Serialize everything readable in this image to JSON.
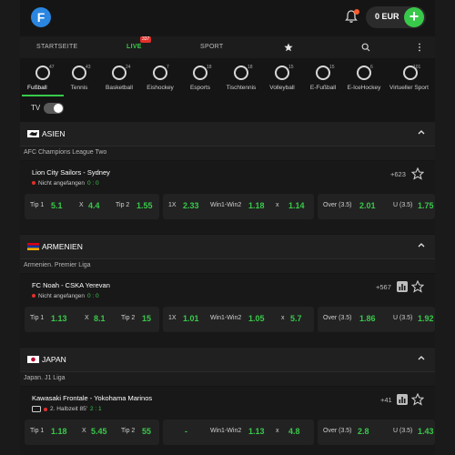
{
  "header": {
    "logo": "F",
    "balance": "0 EUR",
    "plus": "+"
  },
  "nav": {
    "home": "STARTSEITE",
    "live": "LIVE",
    "live_count": "337",
    "sport": "SPORT"
  },
  "sports": [
    {
      "label": "Fußball",
      "count": "47"
    },
    {
      "label": "Tennis",
      "count": "43"
    },
    {
      "label": "Basketball",
      "count": "24"
    },
    {
      "label": "Eishockey",
      "count": "7"
    },
    {
      "label": "Esports",
      "count": "18"
    },
    {
      "label": "Tischtennis",
      "count": "18"
    },
    {
      "label": "Volleyball",
      "count": "15"
    },
    {
      "label": "E-Fußball",
      "count": "15"
    },
    {
      "label": "E-IceHockey",
      "count": "6"
    },
    {
      "label": "Virtueller Sport",
      "count": "101"
    }
  ],
  "tv_label": "TV",
  "sections": [
    {
      "country": "ASIEN",
      "league": "AFC Champions League Two",
      "teams": "Lion City Sailors - Sydney",
      "status": "Nicht angefangen",
      "score": "0 : 0",
      "more": "+623",
      "odds1": [
        {
          "l": "Tip 1",
          "v": "5.1"
        },
        {
          "l": "X",
          "v": "4.4"
        },
        {
          "l": "Tip 2",
          "v": "1.55"
        }
      ],
      "odds2": [
        {
          "l": "1X",
          "v": "2.33"
        },
        {
          "l": "Win1-Win2",
          "v": "1.18"
        },
        {
          "l": "x",
          "v": "1.14"
        }
      ],
      "odds3": [
        {
          "l": "Over (3.5)",
          "v": "2.01"
        },
        {
          "l": "U (3.5)",
          "v": "1.75"
        }
      ]
    },
    {
      "country": "ARMENIEN",
      "league": "Armenien. Premier Liga",
      "teams": "FC Noah - CSKA Yerevan",
      "status": "Nicht angefangen",
      "score": "0 : 0",
      "more": "+567",
      "odds1": [
        {
          "l": "Tip 1",
          "v": "1.13"
        },
        {
          "l": "X",
          "v": "8.1"
        },
        {
          "l": "Tip 2",
          "v": "15"
        }
      ],
      "odds2": [
        {
          "l": "1X",
          "v": "1.01"
        },
        {
          "l": "Win1-Win2",
          "v": "1.05"
        },
        {
          "l": "x",
          "v": "5.7"
        }
      ],
      "odds3": [
        {
          "l": "Over (3.5)",
          "v": "1.86"
        },
        {
          "l": "U (3.5)",
          "v": "1.92"
        }
      ]
    },
    {
      "country": "JAPAN",
      "league": "Japan. J1 Liga",
      "teams": "Kawasaki Frontale - Yokohama Marinos",
      "status": "2. Halbzeit 85'",
      "score": "2 : 1",
      "more": "+41",
      "odds1": [
        {
          "l": "Tip 1",
          "v": "1.18"
        },
        {
          "l": "X",
          "v": "5.45"
        },
        {
          "l": "Tip 2",
          "v": "55"
        }
      ],
      "odds2": [
        {
          "l": "",
          "v": "-"
        },
        {
          "l": "Win1-Win2",
          "v": "1.13"
        },
        {
          "l": "x",
          "v": "4.8"
        }
      ],
      "odds3": [
        {
          "l": "Over (3.5)",
          "v": "2.8"
        },
        {
          "l": "U (3.5)",
          "v": "1.43"
        }
      ]
    }
  ],
  "colors": {
    "accent": "#39c94a",
    "live_red": "#e0302a",
    "logo_blue": "#2a86e0"
  }
}
